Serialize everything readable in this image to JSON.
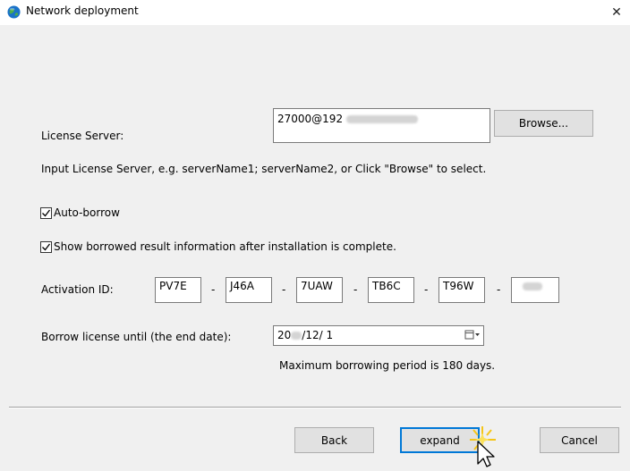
{
  "window": {
    "title": "Network deployment",
    "app_icon": "globe-icon",
    "close_icon": "close-icon",
    "close_glyph": "✕"
  },
  "license_server": {
    "label": "License Server:",
    "value": "27000@192",
    "browse_label": "Browse...",
    "hint": "Input License Server, e.g. serverName1; serverName2, or Click \"Browse\" to select."
  },
  "options": {
    "auto_borrow": {
      "label": "Auto-borrow",
      "checked": true
    },
    "show_result": {
      "label": "Show borrowed result information after installation is complete.",
      "checked": true
    }
  },
  "activation": {
    "label": "Activation ID:",
    "parts": [
      "PV7E",
      "J46A",
      "7UAW",
      "TB6C",
      "T96W",
      ""
    ],
    "separator": "-"
  },
  "borrow": {
    "label": "Borrow license until (the end date):",
    "date_prefix": "20",
    "date_suffix": "/12/  1",
    "calendar_icon": "calendar-dropdown-icon",
    "max_note": "Maximum borrowing period is 180 days."
  },
  "footer": {
    "back_label": "Back",
    "expand_label": "expand",
    "cancel_label": "Cancel"
  },
  "cursor_icon": "mouse-pointer-click-icon"
}
